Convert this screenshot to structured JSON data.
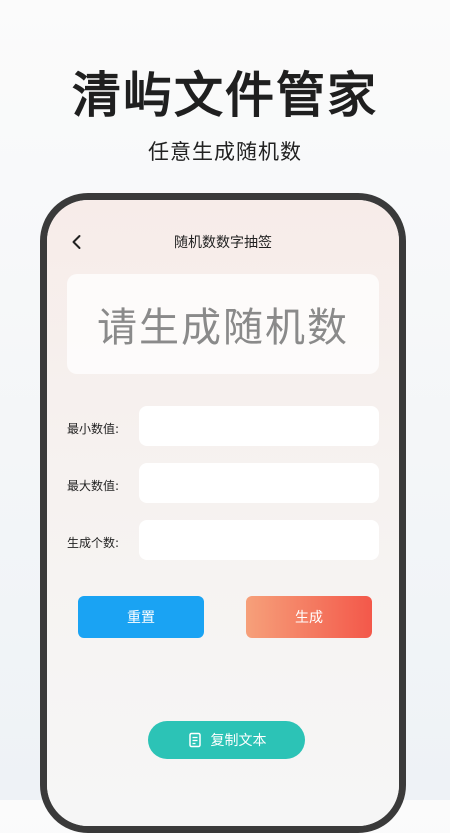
{
  "promo": {
    "headline": "清屿文件管家",
    "subline": "任意生成随机数"
  },
  "nav": {
    "back_icon": "chevron-left-icon",
    "title": "随机数数字抽签"
  },
  "result": {
    "placeholder": "请生成随机数"
  },
  "form": {
    "min_label": "最小数值:",
    "min_value": "",
    "max_label": "最大数值:",
    "max_value": "",
    "count_label": "生成个数:",
    "count_value": ""
  },
  "actions": {
    "reset_label": "重置",
    "generate_label": "生成",
    "copy_label": "复制文本",
    "copy_icon": "copy-icon"
  },
  "colors": {
    "reset": "#1aa3f3",
    "generate_start": "#f6a07a",
    "generate_end": "#f3584a",
    "copy": "#2cc3b6",
    "phone_frame": "#3a3a3a"
  }
}
